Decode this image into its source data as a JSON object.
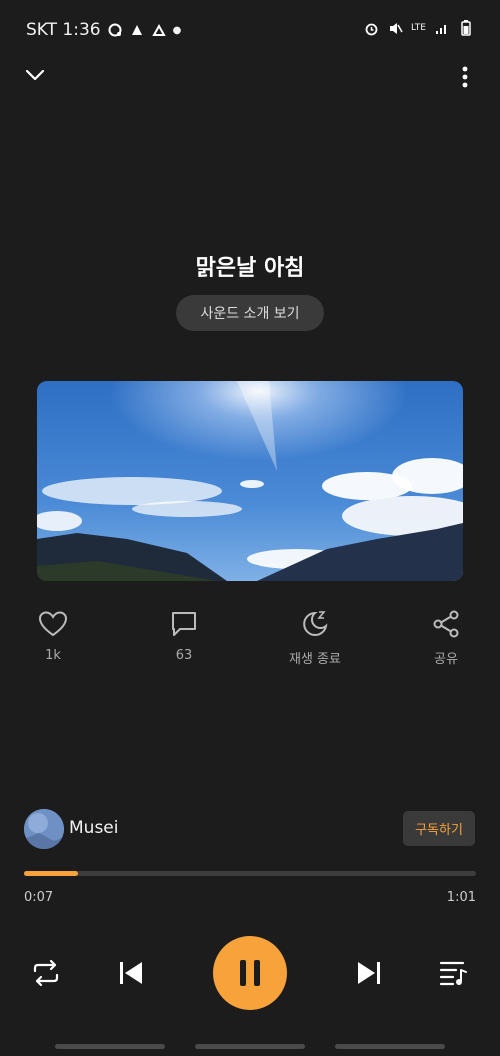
{
  "status": {
    "carrier_time": "SKT 1:36",
    "network": "LTE"
  },
  "track": {
    "title": "맑은날 아침",
    "intro_button": "사운드 소개 보기"
  },
  "actions": {
    "likes": "1k",
    "comments": "63",
    "sleep_timer": "재생 종료",
    "share": "공유"
  },
  "creator": {
    "name": "Musei",
    "subscribe": "구독하기"
  },
  "playback": {
    "current": "0:07",
    "total": "1:01",
    "progress": 0.12
  },
  "colors": {
    "accent": "#f7a23a",
    "background": "#1c1c1c"
  },
  "icons": [
    "chevron-down-icon",
    "more-vert-icon",
    "heart-icon",
    "comment-icon",
    "moon-timer-icon",
    "share-icon",
    "repeat-icon",
    "skip-previous-icon",
    "pause-icon",
    "skip-next-icon",
    "playlist-icon"
  ]
}
